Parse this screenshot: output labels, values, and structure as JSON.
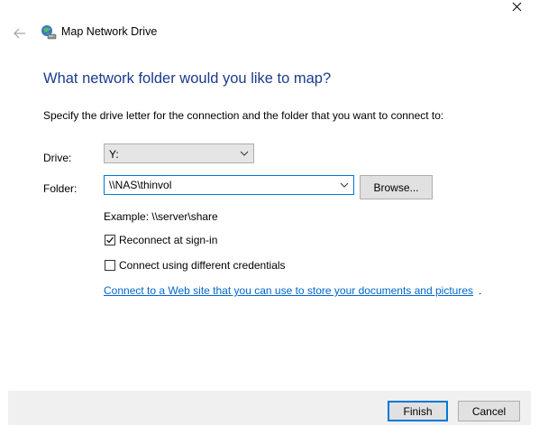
{
  "window": {
    "title": "Map Network Drive"
  },
  "heading": "What network folder would you like to map?",
  "instruction": "Specify the drive letter for the connection and the folder that you want to connect to:",
  "drive": {
    "label": "Drive:",
    "value": "Y:"
  },
  "folder": {
    "label": "Folder:",
    "value": "\\\\NAS\\thinvol",
    "browse_label": "Browse..."
  },
  "example": "Example: \\\\server\\share",
  "reconnect": {
    "label": "Reconnect at sign-in",
    "checked": true
  },
  "different_credentials": {
    "label": "Connect using different credentials",
    "checked": false
  },
  "link": {
    "text": "Connect to a Web site that you can use to store your documents and pictures",
    "suffix": "."
  },
  "footer": {
    "finish_label": "Finish",
    "cancel_label": "Cancel"
  },
  "colors": {
    "heading": "#1a3b8c",
    "link": "#0066cc",
    "focus_border": "#0078d7",
    "footer_bg": "#f0f0f0"
  },
  "icons": {
    "close": "close-icon",
    "back": "back-arrow-icon",
    "network_drive": "network-drive-icon",
    "dropdown": "chevron-down-icon",
    "check": "checkmark-icon"
  }
}
